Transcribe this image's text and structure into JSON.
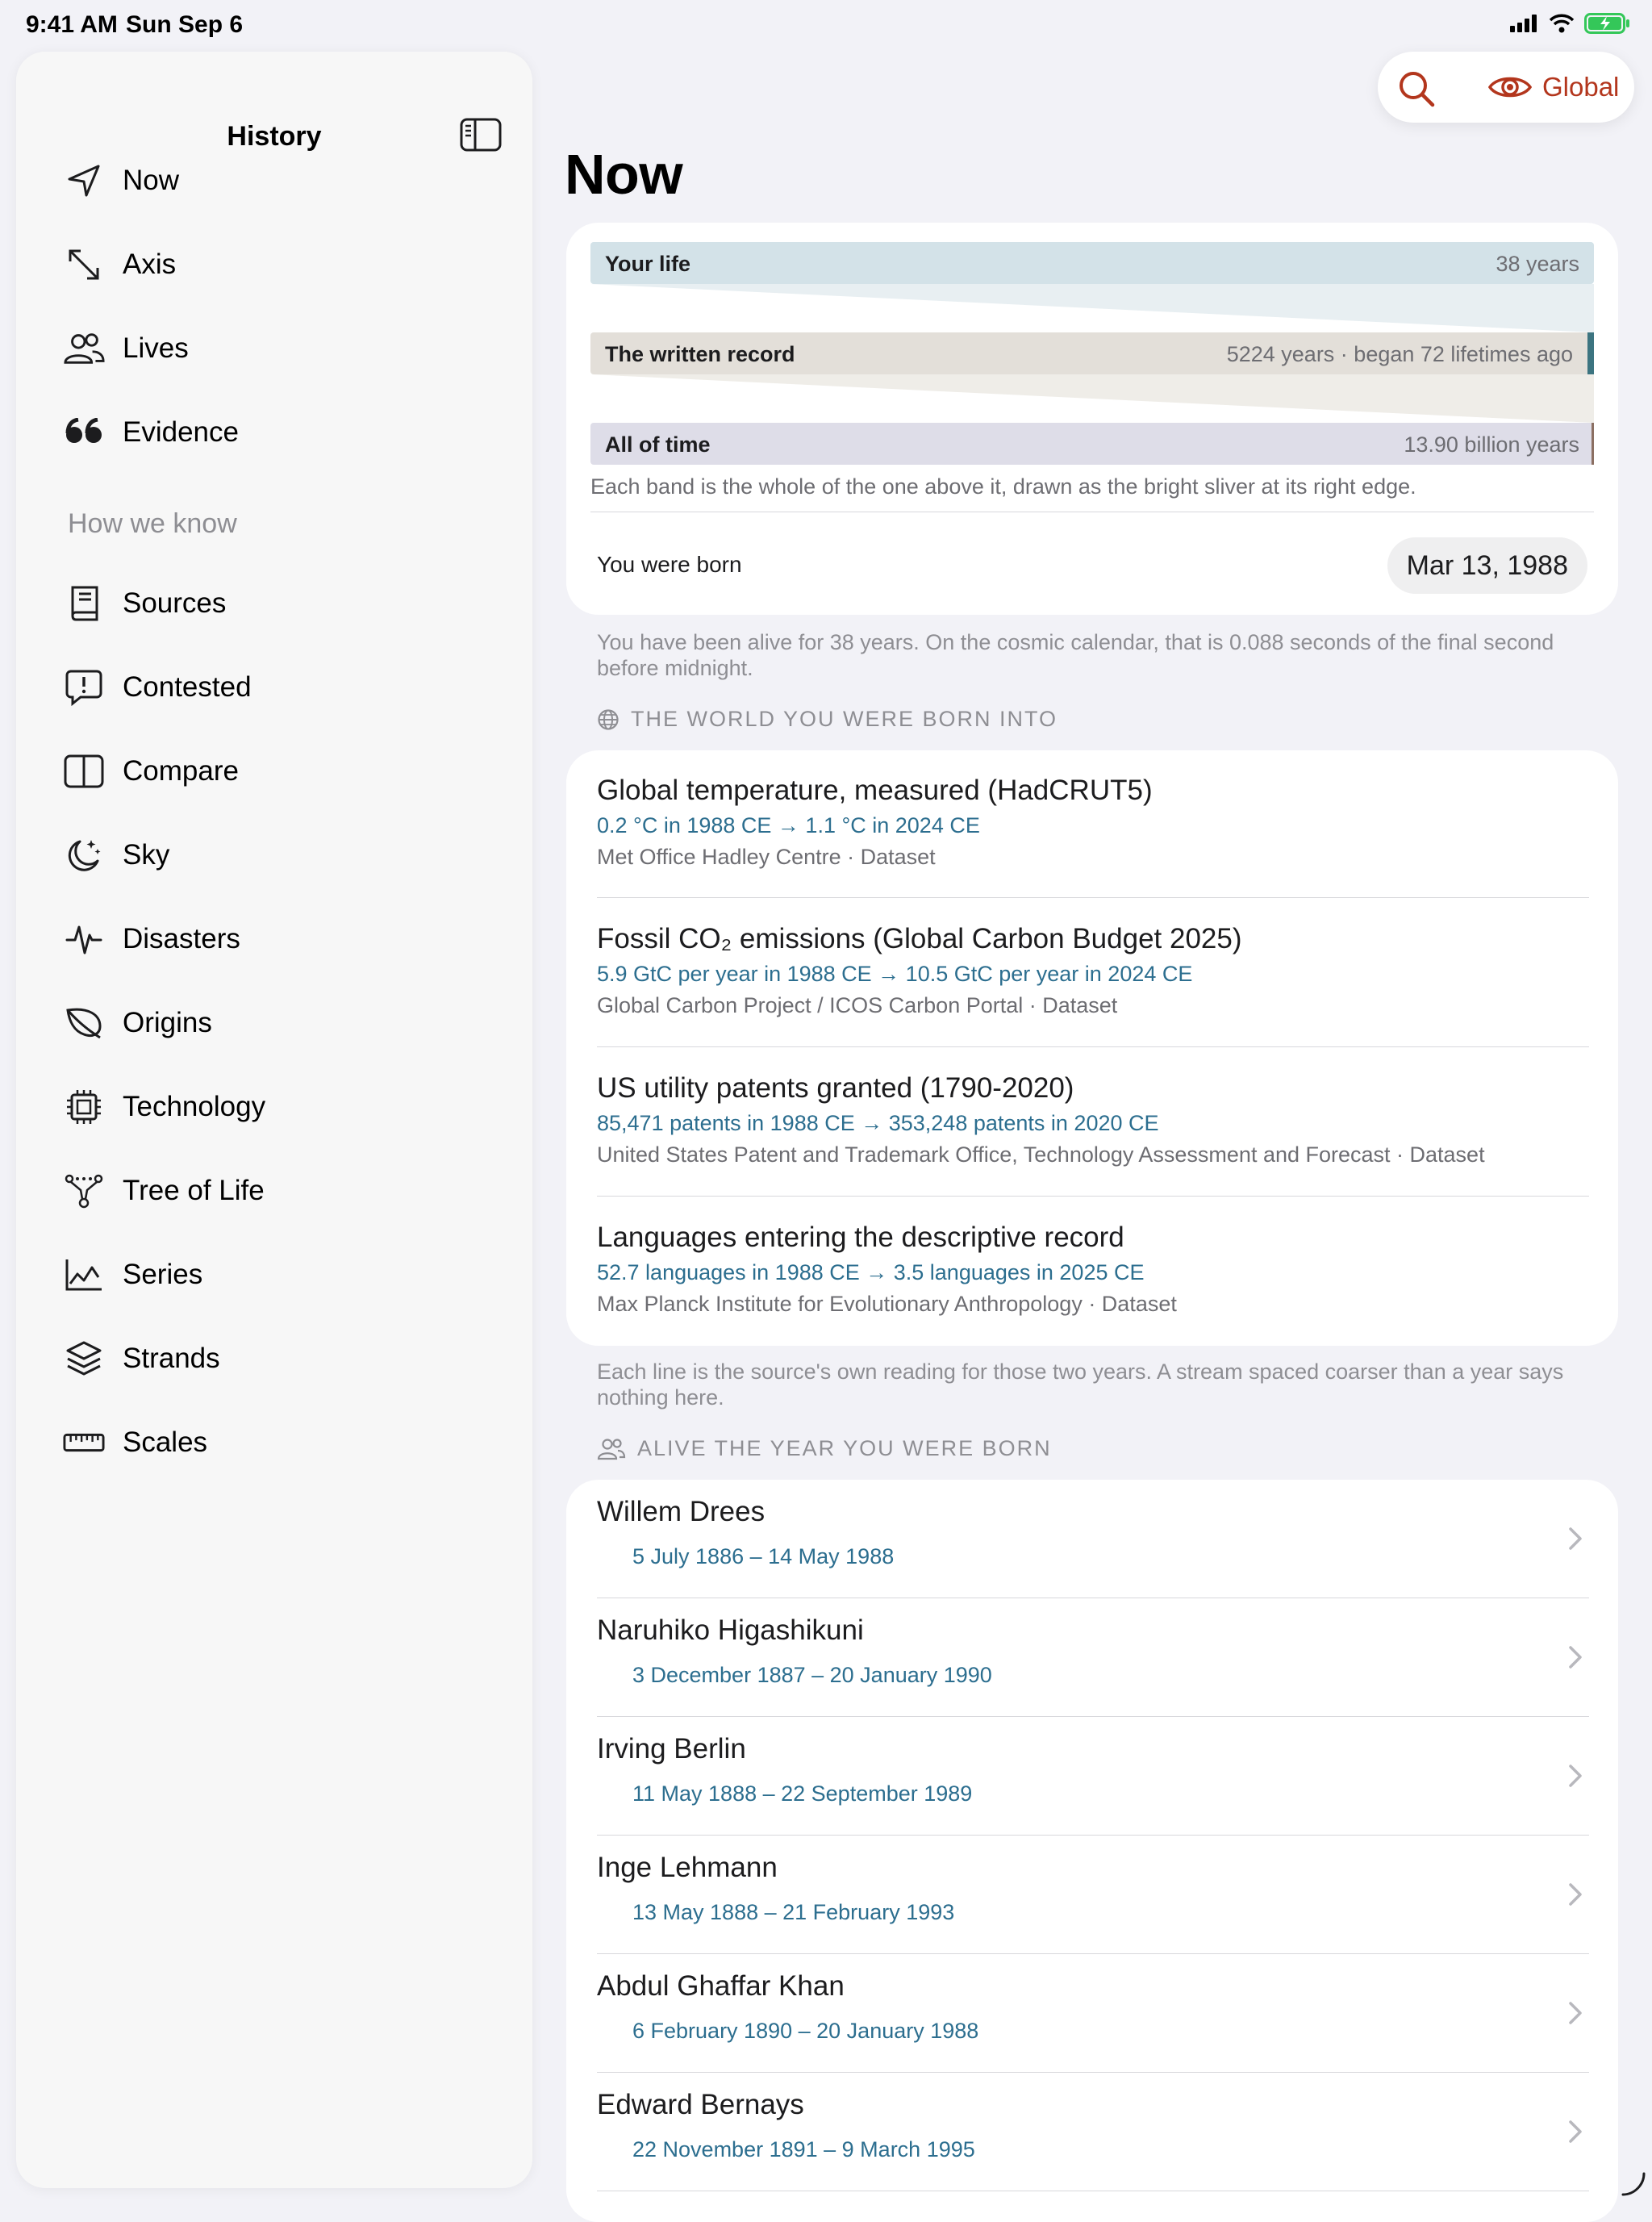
{
  "status_bar": {
    "time": "9:41 AM",
    "date": "Sun Sep 6"
  },
  "sidebar": {
    "title": "History",
    "primary_items": [
      {
        "label": "Now",
        "icon": "location-arrow-icon"
      },
      {
        "label": "Axis",
        "icon": "diagonal-arrows-icon"
      },
      {
        "label": "Lives",
        "icon": "people-icon"
      },
      {
        "label": "Evidence",
        "icon": "quote-icon"
      }
    ],
    "section_label": "How we know",
    "secondary_items": [
      {
        "label": "Sources",
        "icon": "book-icon"
      },
      {
        "label": "Contested",
        "icon": "speech-exclamation-icon"
      },
      {
        "label": "Compare",
        "icon": "split-rectangle-icon"
      },
      {
        "label": "Sky",
        "icon": "moon-stars-icon"
      },
      {
        "label": "Disasters",
        "icon": "waveform-icon"
      },
      {
        "label": "Origins",
        "icon": "leaf-icon"
      },
      {
        "label": "Technology",
        "icon": "cpu-icon"
      },
      {
        "label": "Tree of Life",
        "icon": "tree-nodes-icon"
      },
      {
        "label": "Series",
        "icon": "line-chart-icon"
      },
      {
        "label": "Strands",
        "icon": "layers-icon"
      },
      {
        "label": "Scales",
        "icon": "ruler-icon"
      }
    ]
  },
  "header": {
    "scope_label": "Global",
    "accent_color": "#b3361d"
  },
  "page": {
    "title": "Now"
  },
  "bands": [
    {
      "label": "Your life",
      "value": "38 years",
      "color": "#d3e2e8",
      "sliver_color": "#d3e2e8"
    },
    {
      "label": "The written record",
      "value": "5224 years · began 72 lifetimes ago",
      "color": "#e3dfd9",
      "sliver_color": "#3c7480"
    },
    {
      "label": "All of time",
      "value": "13.90 billion years",
      "color": "#dedde8",
      "sliver_color": "#8b6f62"
    }
  ],
  "band_note": "Each band is the whole of the one above it, drawn as the bright sliver at its right edge.",
  "born": {
    "label": "You were born",
    "date": "Mar 13, 1988"
  },
  "alive_caption": "You have been alive for 38 years. On the cosmic calendar, that is 0.088 seconds of the final second before midnight.",
  "world_section": {
    "heading": "THE WORLD YOU WERE BORN INTO",
    "datasets": [
      {
        "title": "Global temperature, measured (HadCRUT5)",
        "values": "0.2 °C in 1988 CE → 1.1 °C in 2024 CE",
        "source": "Met Office Hadley Centre · Dataset"
      },
      {
        "title": "Fossil CO₂ emissions (Global Carbon Budget 2025)",
        "values": "5.9 GtC per year in 1988 CE → 10.5 GtC per year in 2024 CE",
        "source": "Global Carbon Project / ICOS Carbon Portal · Dataset"
      },
      {
        "title": "US utility patents granted (1790-2020)",
        "values": "85,471 patents in 1988 CE → 353,248 patents in 2020 CE",
        "source": "United States Patent and Trademark Office, Technology Assessment and Forecast · Dataset"
      },
      {
        "title": "Languages entering the descriptive record",
        "values": "52.7 languages in 1988 CE → 3.5 languages in 2025 CE",
        "source": "Max Planck Institute for Evolutionary Anthropology · Dataset"
      }
    ],
    "caption": "Each line is the source's own reading for those two years. A stream spaced coarser than a year says nothing here."
  },
  "alive_section": {
    "heading": "ALIVE THE YEAR YOU WERE BORN",
    "people": [
      {
        "name": "Willem Drees",
        "dates": "5 July 1886 – 14 May 1988"
      },
      {
        "name": "Naruhiko Higashikuni",
        "dates": "3 December 1887 – 20 January 1990"
      },
      {
        "name": "Irving Berlin",
        "dates": "11 May 1888 – 22 September 1989"
      },
      {
        "name": "Inge Lehmann",
        "dates": "13 May 1888 – 21 February 1993"
      },
      {
        "name": "Abdul Ghaffar Khan",
        "dates": "6 February 1890 – 20 January 1988"
      },
      {
        "name": "Edward Bernays",
        "dates": "22 November 1891 – 9 March 1995"
      }
    ]
  }
}
